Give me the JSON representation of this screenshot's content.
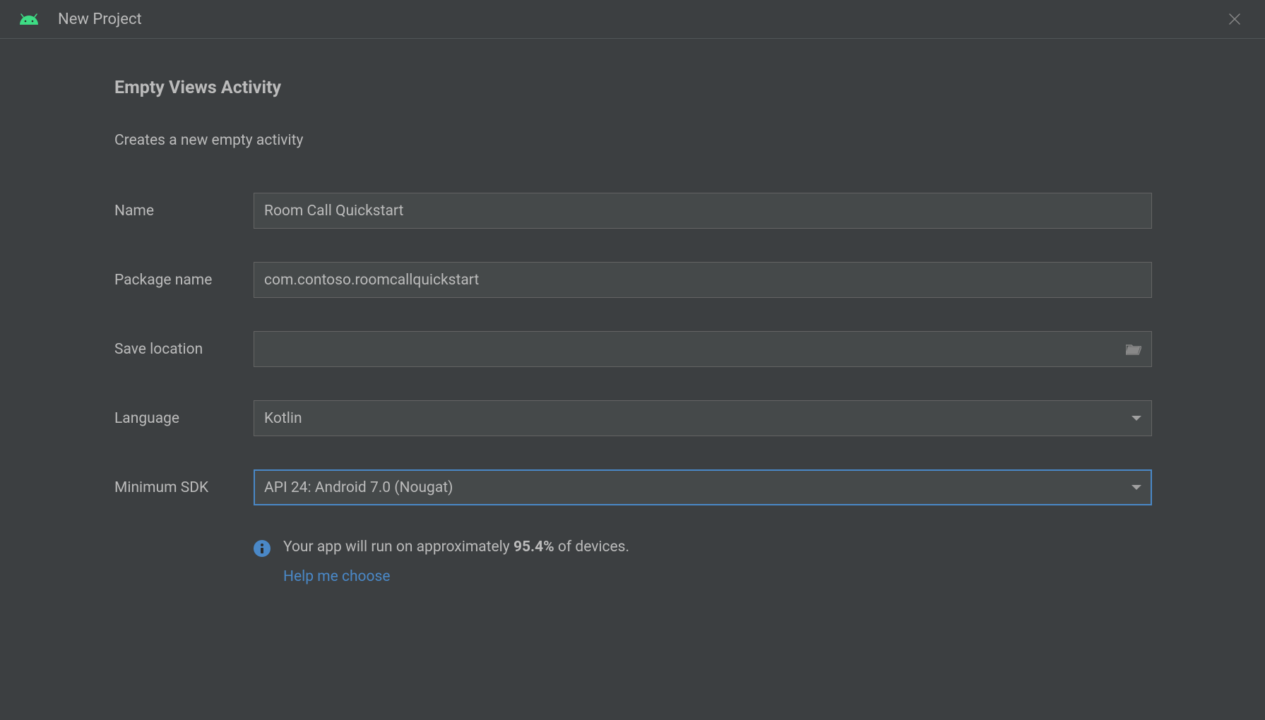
{
  "titlebar": {
    "title": "New Project"
  },
  "header": {
    "heading": "Empty Views Activity",
    "subtitle": "Creates a new empty activity"
  },
  "form": {
    "name": {
      "label": "Name",
      "value": "Room Call Quickstart"
    },
    "package_name": {
      "label": "Package name",
      "value": "com.contoso.roomcallquickstart"
    },
    "save_location": {
      "label": "Save location",
      "value": ""
    },
    "language": {
      "label": "Language",
      "value": "Kotlin"
    },
    "minimum_sdk": {
      "label": "Minimum SDK",
      "value": "API 24: Android 7.0 (Nougat)"
    }
  },
  "info": {
    "text_prefix": "Your app will run on approximately ",
    "percent": "95.4%",
    "text_suffix": " of devices.",
    "help_link": "Help me choose"
  }
}
